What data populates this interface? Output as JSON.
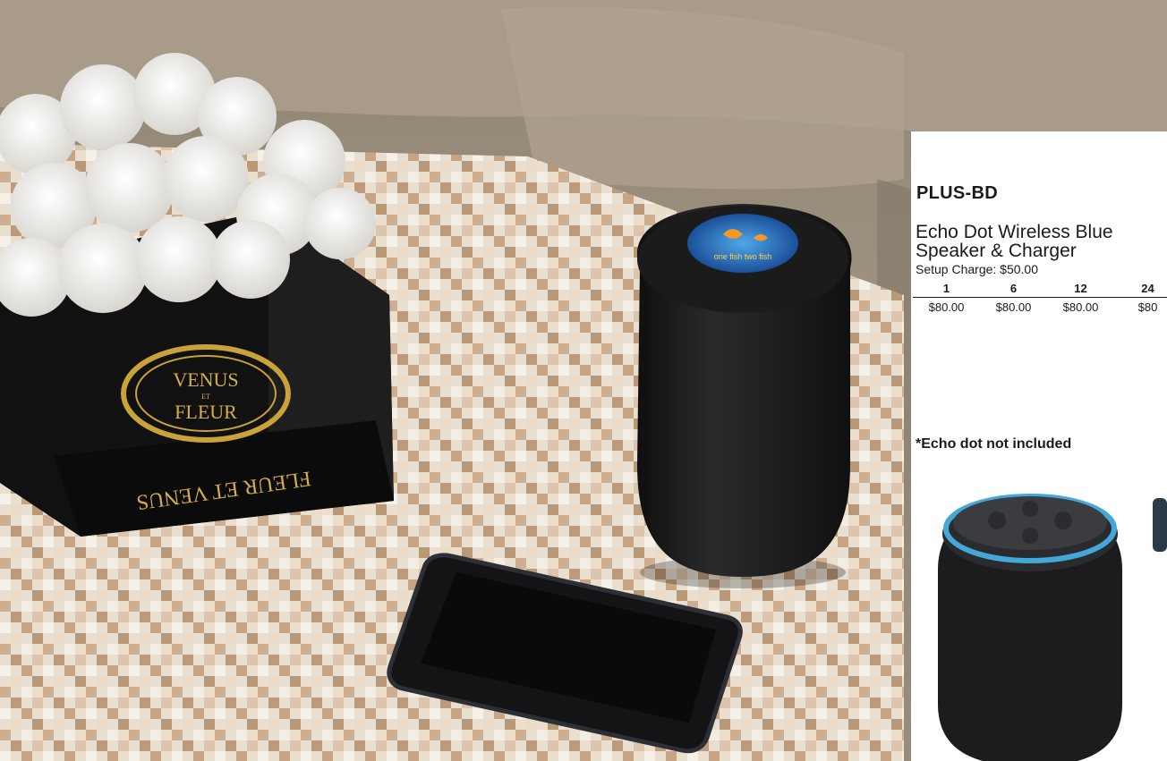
{
  "photo": {
    "box_lettering_top": "VENUS",
    "box_lettering_mid": "ET",
    "box_lettering_bottom": "FLEUR",
    "box_side_lettering": "FLEUR ET VENUS",
    "speaker_top_label": "one fish two fish"
  },
  "product": {
    "sku": "PLUS-BD",
    "name_line1": "Echo Dot Wireless Blue",
    "name_line2": "Speaker & Charger",
    "setup_charge": "Setup Charge: $50.00",
    "note": "*Echo dot not included"
  },
  "pricing": {
    "quantities": [
      "1",
      "6",
      "12",
      "24"
    ],
    "prices": [
      "$80.00",
      "$80.00",
      "$80.00",
      "$80"
    ]
  },
  "colors": {
    "speaker_fabric": "#1c1c1e",
    "echo_ring": "#45a6d8",
    "box_gold": "#c9a23a",
    "sofa": "#9c8f7f"
  }
}
